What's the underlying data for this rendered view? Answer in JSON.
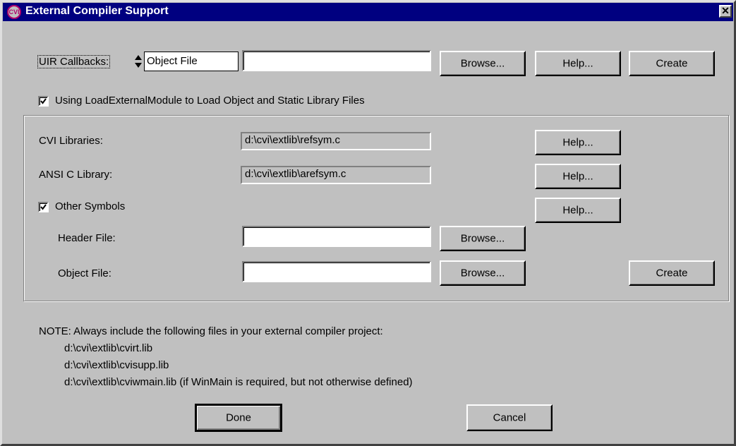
{
  "window": {
    "title": "External Compiler Support",
    "app_icon": "cvi-logo-icon",
    "close_glyph": "✕"
  },
  "uir": {
    "label_prefix": "UIR Callbacks:",
    "ring_value": "Object File",
    "path_value": "",
    "browse_label": "Browse...",
    "help_label": "Help...",
    "create_label": "Create"
  },
  "load_external": {
    "checked": true,
    "label": "Using LoadExternalModule to Load Object and Static Library Files"
  },
  "group": {
    "cvi_libraries": {
      "label": "CVI Libraries:",
      "value": "d:\\cvi\\extlib\\refsym.c",
      "help_label": "Help..."
    },
    "ansi_c_library": {
      "label": "ANSI C Library:",
      "value": "d:\\cvi\\extlib\\arefsym.c",
      "help_label": "Help..."
    },
    "other_symbols": {
      "checked": true,
      "label": "Other Symbols",
      "help_label": "Help...",
      "header_file": {
        "label": "Header File:",
        "value": "",
        "browse_label": "Browse..."
      },
      "object_file": {
        "label": "Object File:",
        "value": "",
        "browse_label": "Browse...",
        "create_label": "Create"
      }
    }
  },
  "note": {
    "heading": "NOTE: Always include the following files in your external compiler project:",
    "files": [
      "d:\\cvi\\extlib\\cvirt.lib",
      "d:\\cvi\\extlib\\cvisupp.lib",
      "d:\\cvi\\extlib\\cviwmain.lib (if WinMain is required, but not otherwise defined)"
    ]
  },
  "footer": {
    "done_label": "Done",
    "cancel_label": "Cancel"
  }
}
